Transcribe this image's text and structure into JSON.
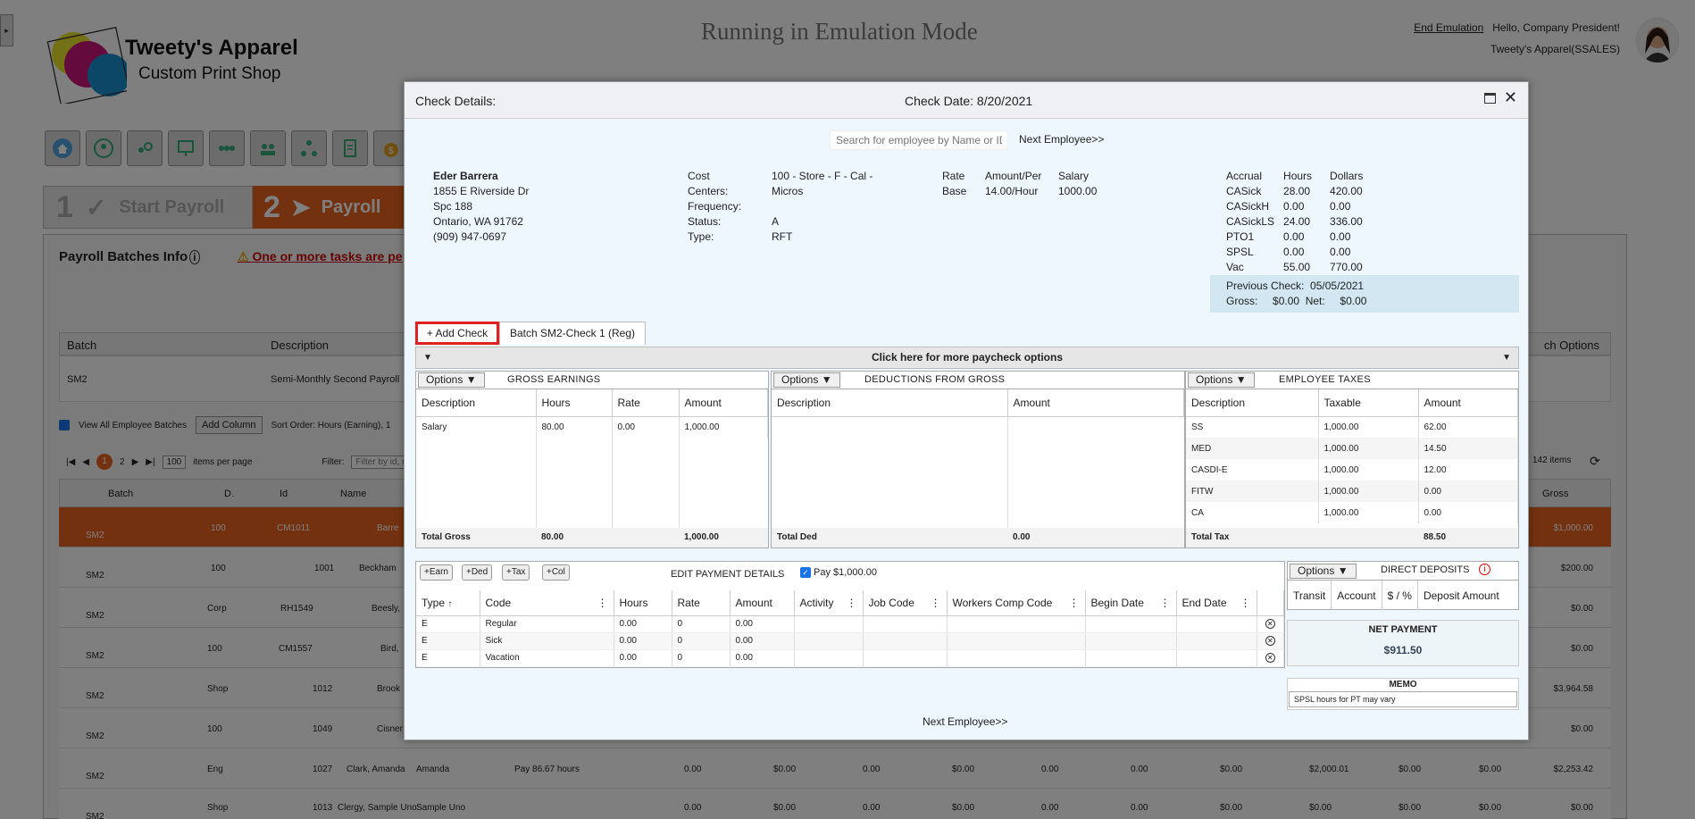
{
  "app": {
    "logo_line1": "Tweety's Apparel",
    "logo_line2": "Custom Print Shop",
    "emulation_banner": "Running in Emulation Mode",
    "end_emulation": "End Emulation",
    "greeting": "Hello, Company President!",
    "company": "Tweety's Apparel(SSALES)"
  },
  "steps": [
    {
      "num": "1",
      "label": "Start Payroll"
    },
    {
      "num": "2",
      "label": "Payroll"
    }
  ],
  "background": {
    "panel_title": "Payroll Batches Info",
    "warning": "One or more tasks are pe",
    "col_batch": "Batch",
    "col_description": "Description",
    "batch_value": "SM2",
    "batch_desc": "Semi-Monthly Second Payroll",
    "view_all": "View All Employee Batches",
    "add_column": "Add Column",
    "sort_order": "Sort Order: Hours (Earning), 1",
    "per_page": "100",
    "items_per_page": "items per page",
    "filter": "Filter:",
    "filter_placeholder": "Filter by id, na",
    "total_items": "142 items",
    "batch_options": "ch Options",
    "grid_cols": [
      "Batch",
      "D.",
      "Id",
      "Name",
      "Gross"
    ],
    "rows": [
      {
        "batch": "SM2",
        "d": "100",
        "id": "CM1011",
        "name": "Barre",
        "gross": "$1,000.00"
      },
      {
        "batch": "SM2",
        "d": "100",
        "id": "1001",
        "name": "Beckham",
        "gross": "$200.00"
      },
      {
        "batch": "SM2",
        "d": "Corp",
        "id": "RH1549",
        "name": "Beesly,",
        "gross": "$0.00"
      },
      {
        "batch": "SM2",
        "d": "100",
        "id": "CM1557",
        "name": "Bird,",
        "gross": "$0.00"
      },
      {
        "batch": "SM2",
        "d": "Shop",
        "id": "1012",
        "name": "Brook",
        "gross": "$3,964.58"
      },
      {
        "batch": "SM2",
        "d": "100",
        "id": "1049",
        "name": "Cisner",
        "gross": "$0.00"
      },
      {
        "batch": "SM2",
        "d": "Eng",
        "id": "1027",
        "name": "Clark, Amanda",
        "gross": "$2,253.42"
      },
      {
        "batch": "SM2",
        "d": "Shop",
        "id": "1013",
        "name": "Clergy, Sample Uno",
        "gross": "$0.00"
      }
    ],
    "clark_first": "Amanda",
    "clark_pay": "Pay 86.67 hours",
    "clark_cells": [
      "0.00",
      "$0.00",
      "0.00",
      "$0.00",
      "0.00",
      "0.00",
      "$0.00",
      "$2,000.01",
      "$0.00",
      "$0.00"
    ],
    "clergy_first": "Sample Uno",
    "clergy_cells": [
      "0.00",
      "$0.00",
      "0.00",
      "$0.00",
      "0.00",
      "0.00",
      "$0.00",
      "$0.00",
      "$0.00",
      "$0.00"
    ]
  },
  "modal": {
    "title": "Check Details:",
    "check_date": "Check Date: 8/20/2021",
    "search_placeholder": "Search for employee by Name or ID",
    "next_employee": "Next Employee>>",
    "employee": {
      "name": "Eder Barrera",
      "address1": "1855 E Riverside Dr",
      "address2": "Spc 188",
      "city": "Ontario, WA 91762",
      "phone": "(909) 947-0697"
    },
    "info": {
      "cost_centers_label1": "Cost",
      "cost_centers_label2": "Centers:",
      "cost_centers_value1": "100 - Store - F - Cal -",
      "cost_centers_value2": "Micros",
      "frequency_label": "Frequency:",
      "status_label": "Status:",
      "status_value": "A",
      "type_label": "Type:",
      "type_value": "RFT",
      "rate_label": "Rate",
      "base_label": "Base",
      "amount_per_label": "Amount/Per",
      "amount_per_value": "14.00/Hour",
      "salary_label": "Salary",
      "salary_value": "1000.00"
    },
    "accrual": {
      "headers": [
        "Accrual",
        "Hours",
        "Dollars"
      ],
      "rows": [
        [
          "CASick",
          "28.00",
          "420.00"
        ],
        [
          "CASickH",
          "0.00",
          "0.00"
        ],
        [
          "CASickLS",
          "24.00",
          "336.00"
        ],
        [
          "PTO1",
          "0.00",
          "0.00"
        ],
        [
          "SPSL",
          "0.00",
          "0.00"
        ],
        [
          "Vac",
          "55.00",
          "770.00"
        ]
      ]
    },
    "previous": {
      "label": "Previous Check:",
      "date": "05/05/2021",
      "gross_label": "Gross:",
      "gross": "$0.00",
      "net_label": "Net:",
      "net": "$0.00"
    },
    "tabs": {
      "add_check": "+ Add Check",
      "batch": "Batch SM2-Check 1 (Reg)"
    },
    "more_options": "Click here for more paycheck options",
    "options_label": "Options",
    "gross_earnings": {
      "title": "GROSS EARNINGS",
      "headers": [
        "Description",
        "Hours",
        "Rate",
        "Amount"
      ],
      "rows": [
        [
          "Salary",
          "80.00",
          "0.00",
          "1,000.00"
        ]
      ],
      "total_label": "Total Gross",
      "total_hours": "80.00",
      "total_amount": "1,000.00"
    },
    "deductions": {
      "title": "DEDUCTIONS FROM GROSS",
      "headers": [
        "Description",
        "Amount"
      ],
      "total_label": "Total Ded",
      "total_amount": "0.00"
    },
    "taxes": {
      "title": "EMPLOYEE TAXES",
      "headers": [
        "Description",
        "Taxable",
        "Amount"
      ],
      "rows": [
        [
          "SS",
          "1,000.00",
          "62.00"
        ],
        [
          "MED",
          "1,000.00",
          "14.50"
        ],
        [
          "CASDI-E",
          "1,000.00",
          "12.00"
        ],
        [
          "FITW",
          "1,000.00",
          "0.00"
        ],
        [
          "CA",
          "1,000.00",
          "0.00"
        ]
      ],
      "total_label": "Total Tax",
      "total_amount": "88.50"
    },
    "payment": {
      "btn_earn": "+Earn",
      "btn_ded": "+Ded",
      "btn_tax": "+Tax",
      "btn_col": "+Col",
      "title": "EDIT PAYMENT DETAILS",
      "pay_check": "Pay $1,000.00",
      "headers": [
        "Type",
        "Code",
        "Hours",
        "Rate",
        "Amount",
        "Activity",
        "Job Code",
        "Workers Comp Code",
        "Begin Date",
        "End Date"
      ],
      "rows": [
        [
          "E",
          "Regular",
          "0.00",
          "0",
          "0.00"
        ],
        [
          "E",
          "Sick",
          "0.00",
          "0",
          "0.00"
        ],
        [
          "E",
          "Vacation",
          "0.00",
          "0",
          "0.00"
        ]
      ]
    },
    "direct_deposits": {
      "title": "DIRECT DEPOSITS",
      "headers": [
        "Transit",
        "Account",
        "$ / %",
        "Deposit Amount"
      ]
    },
    "net_payment": {
      "label": "NET PAYMENT",
      "value": "$911.50"
    },
    "memo": {
      "label": "MEMO",
      "value": "SPSL hours for PT may vary"
    }
  }
}
